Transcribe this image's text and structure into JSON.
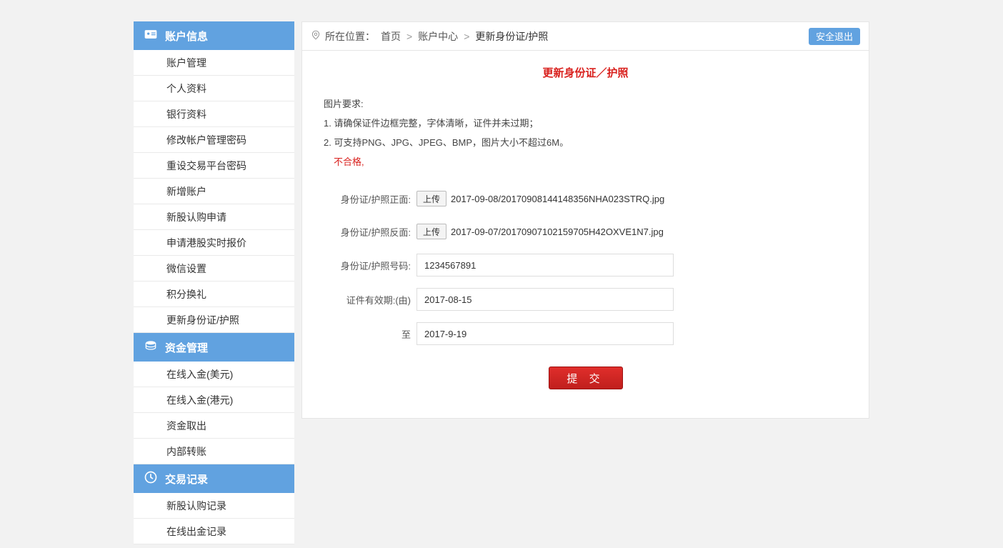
{
  "sidebar": {
    "sections": [
      {
        "title": "账户信息",
        "icon": "id-card",
        "items": [
          "账户管理",
          "个人资料",
          "银行资料",
          "修改帐户管理密码",
          "重设交易平台密码",
          "新增账户",
          "新股认购申请",
          "申请港股实时报价",
          "微信设置",
          "积分换礼",
          "更新身份证/护照"
        ]
      },
      {
        "title": "资金管理",
        "icon": "coins",
        "items": [
          "在线入金(美元)",
          "在线入金(港元)",
          "资金取出",
          "内部转账"
        ]
      },
      {
        "title": "交易记录",
        "icon": "clock",
        "items": [
          "新股认购记录",
          "在线出金记录"
        ]
      }
    ]
  },
  "breadcrumb": {
    "location_label": "所在位置：",
    "items": [
      "首页",
      "账户中心",
      "更新身份证/护照"
    ],
    "logout": "安全退出"
  },
  "panel": {
    "title": "更新身份证／护照",
    "req_heading": "图片要求:",
    "req_line1": "1. 请确保证件边框完整，字体清晰，证件并未过期；",
    "req_line2": "2. 可支持PNG、JPG、JPEG、BMP，图片大小不超过6M。",
    "invalid": "不合格,",
    "front_label": "身份证/护照正面:",
    "back_label": "身份证/护照反面:",
    "upload_btn": "上传",
    "front_file": "2017-09-08/20170908144148356NHA023STRQ.jpg",
    "back_file": "2017-09-07/20170907102159705H42OXVE1N7.jpg",
    "number_label": "身份证/护照号码:",
    "number_value": "1234567891",
    "valid_from_label": "证件有效期:(由)",
    "valid_from_value": "2017-08-15",
    "valid_to_label": "至",
    "valid_to_value": "2017-9-19",
    "submit": "提 交"
  }
}
